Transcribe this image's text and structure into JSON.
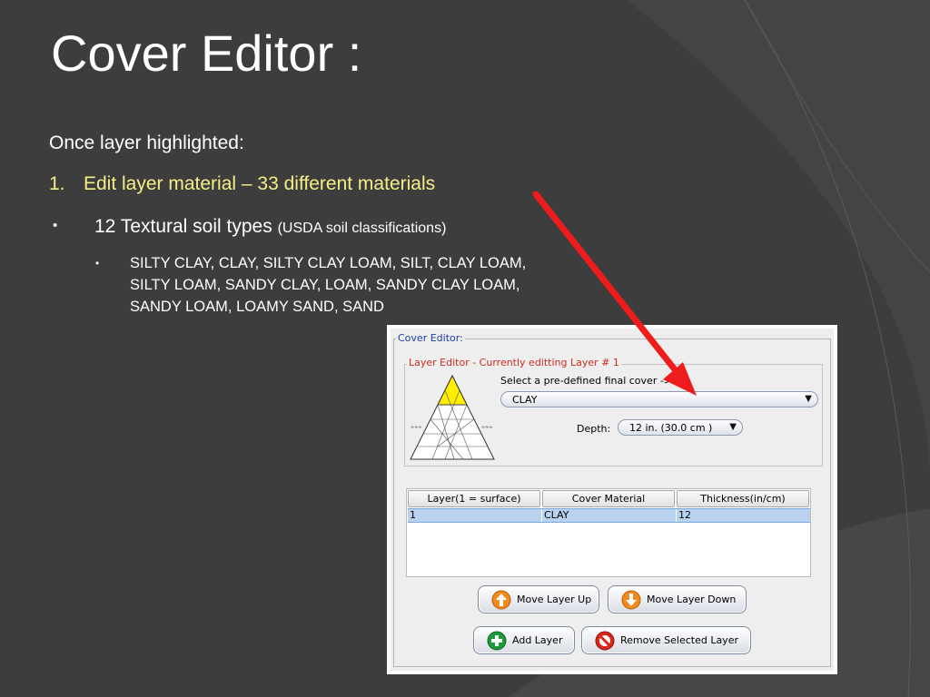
{
  "slide": {
    "title": "Cover Editor :",
    "intro": "Once layer highlighted:",
    "numbered": {
      "number": "1.",
      "text": "Edit layer material – 33 different materials"
    },
    "bullet": {
      "symbol": "•",
      "text": "12 Textural soil types ",
      "small": "(USDA soil classifications)"
    },
    "sub_bullet": {
      "symbol": "•",
      "text": "SILTY CLAY,  CLAY, SILTY CLAY LOAM, SILT, CLAY LOAM, SILTY LOAM, SANDY CLAY, LOAM,  SANDY CLAY LOAM, SANDY LOAM, LOAMY SAND, SAND"
    },
    "colors": {
      "background": "#3d3d3d",
      "highlight_text": "#f3ef86",
      "arrow": "#ee1c1c"
    }
  },
  "app": {
    "group_title": "Cover Editor:",
    "layer_editor_title": "Layer Editor - Currently editting Layer # 1",
    "select_label": "Select a pre-defined final cover ->",
    "cover_value": "CLAY",
    "depth_label": "Depth:",
    "depth_value": "12 in. (30.0 cm )",
    "triangle_icon": "usda-soil-texture-triangle",
    "table": {
      "headers": [
        "Layer(1 = surface)",
        "Cover Material",
        "Thickness(in/cm)"
      ],
      "rows": [
        [
          "1",
          "CLAY",
          "12"
        ]
      ]
    },
    "buttons": {
      "move_up": "Move Layer Up",
      "move_down": "Move Layer Down",
      "add": "Add Layer",
      "remove": "Remove Selected Layer"
    },
    "icons": {
      "move_up": "arrow-up-icon",
      "move_down": "arrow-down-icon",
      "add": "plus-icon",
      "remove": "no-entry-icon"
    }
  }
}
